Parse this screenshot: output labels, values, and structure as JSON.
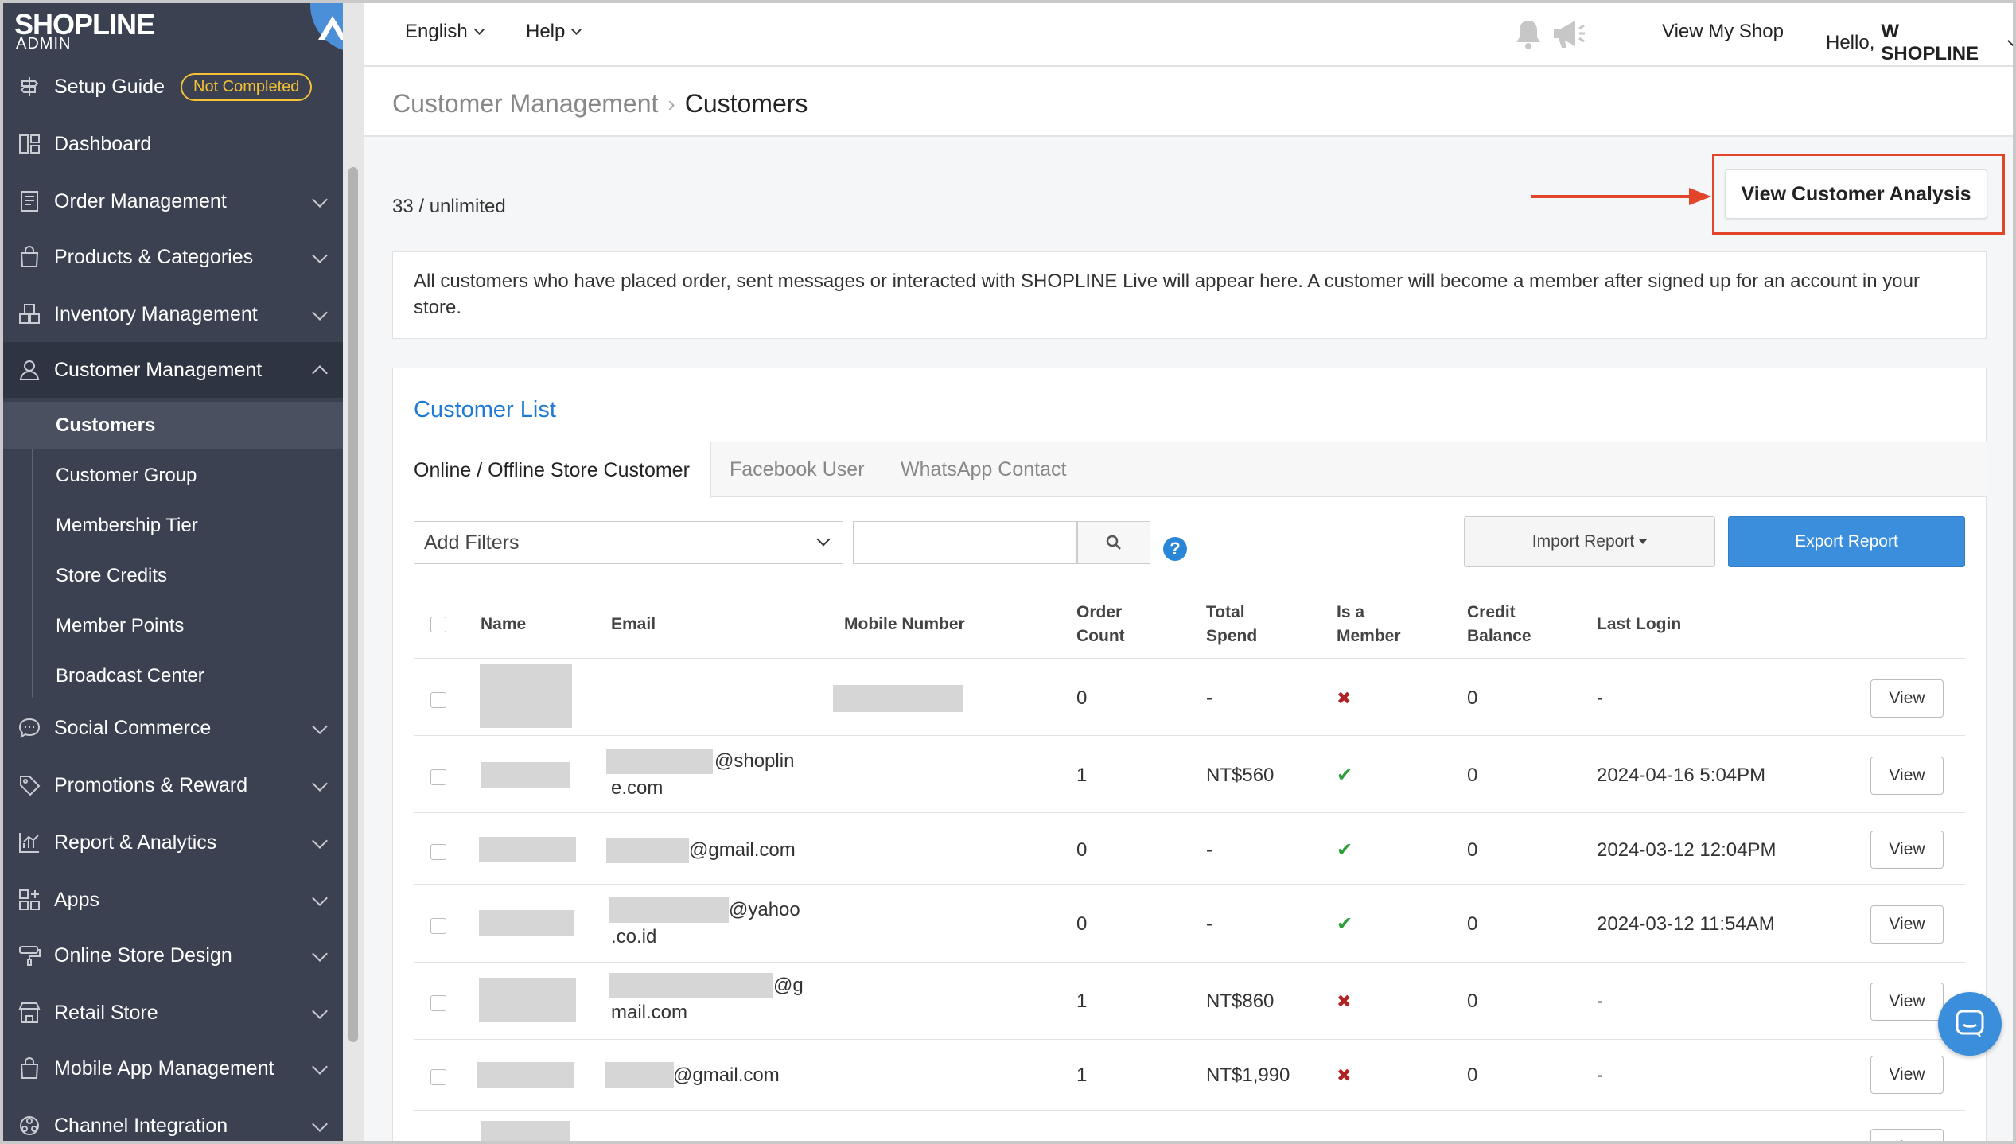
{
  "brand": {
    "logo": "SHOPLINE",
    "logo_sub": "ADMIN"
  },
  "sidebar": {
    "setup_guide": {
      "label": "Setup Guide",
      "badge": "Not Completed"
    },
    "items": [
      {
        "label": "Dashboard",
        "icon": "dashboard-icon"
      },
      {
        "label": "Order Management",
        "icon": "order-icon"
      },
      {
        "label": "Products & Categories",
        "icon": "bag-icon"
      },
      {
        "label": "Inventory Management",
        "icon": "inventory-icon"
      },
      {
        "label": "Customer Management",
        "icon": "user-icon"
      },
      {
        "label": "Social Commerce",
        "icon": "chat-icon"
      },
      {
        "label": "Promotions & Reward",
        "icon": "tag-icon"
      },
      {
        "label": "Report & Analytics",
        "icon": "chart-icon"
      },
      {
        "label": "Apps",
        "icon": "apps-icon"
      },
      {
        "label": "Online Store Design",
        "icon": "brush-icon"
      },
      {
        "label": "Retail Store",
        "icon": "store-icon"
      },
      {
        "label": "Mobile App Management",
        "icon": "mobile-bag-icon"
      },
      {
        "label": "Channel Integration",
        "icon": "channel-icon"
      }
    ],
    "sub_items": [
      "Customers",
      "Customer Group",
      "Membership Tier",
      "Store Credits",
      "Member Points",
      "Broadcast Center"
    ]
  },
  "topbar": {
    "language": "English",
    "help": "Help",
    "view_shop": "View My Shop",
    "greeting": "Hello,",
    "user": "W SHOPLINE"
  },
  "breadcrumb": {
    "parent": "Customer Management",
    "current": "Customers"
  },
  "page": {
    "count": "33 / unlimited",
    "analysis_button": "View Customer Analysis",
    "info": "All customers who have placed order, sent messages or interacted with SHOPLINE Live will appear here. A customer will become a member after signed up for an account in your store."
  },
  "customer_list": {
    "title": "Customer List",
    "tabs": [
      "Online / Offline Store Customer",
      "Facebook User",
      "WhatsApp Contact"
    ],
    "filter_placeholder": "Add Filters",
    "import_button": "Import Report",
    "export_button": "Export Report",
    "headers": {
      "name": "Name",
      "email": "Email",
      "mobile": "Mobile Number",
      "order_count_1": "Order",
      "order_count_2": "Count",
      "total_spend_1": "Total",
      "total_spend_2": "Spend",
      "member_1": "Is a",
      "member_2": "Member",
      "credit_1": "Credit",
      "credit_2": "Balance",
      "last_login": "Last Login"
    },
    "view_label": "View",
    "rows": [
      {
        "email_1": "",
        "email_2": "",
        "order_count": "0",
        "total_spend": "-",
        "member": "✖",
        "credit": "0",
        "last_login": "-"
      },
      {
        "email_1": "@shoplin",
        "email_2": "e.com",
        "order_count": "1",
        "total_spend": "NT$560",
        "member": "✔",
        "credit": "0",
        "last_login": "2024-04-16 5:04PM"
      },
      {
        "email_1": "@gmail.com",
        "email_2": "",
        "order_count": "0",
        "total_spend": "-",
        "member": "✔",
        "credit": "0",
        "last_login": "2024-03-12 12:04PM"
      },
      {
        "email_1": "@yahoo",
        "email_2": ".co.id",
        "order_count": "0",
        "total_spend": "-",
        "member": "✔",
        "credit": "0",
        "last_login": "2024-03-12 11:54AM"
      },
      {
        "email_1": "@g",
        "email_2": "mail.com",
        "order_count": "1",
        "total_spend": "NT$860",
        "member": "✖",
        "credit": "0",
        "last_login": "-"
      },
      {
        "email_1": "@gmail.com",
        "email_2": "",
        "order_count": "1",
        "total_spend": "NT$1,990",
        "member": "✖",
        "credit": "0",
        "last_login": "-"
      }
    ]
  },
  "colors": {
    "accent": "#3a8edb",
    "sidebar": "#3b4151",
    "highlight": "#e2452a",
    "check": "#2e9e3a",
    "cross": "#c0392b"
  }
}
